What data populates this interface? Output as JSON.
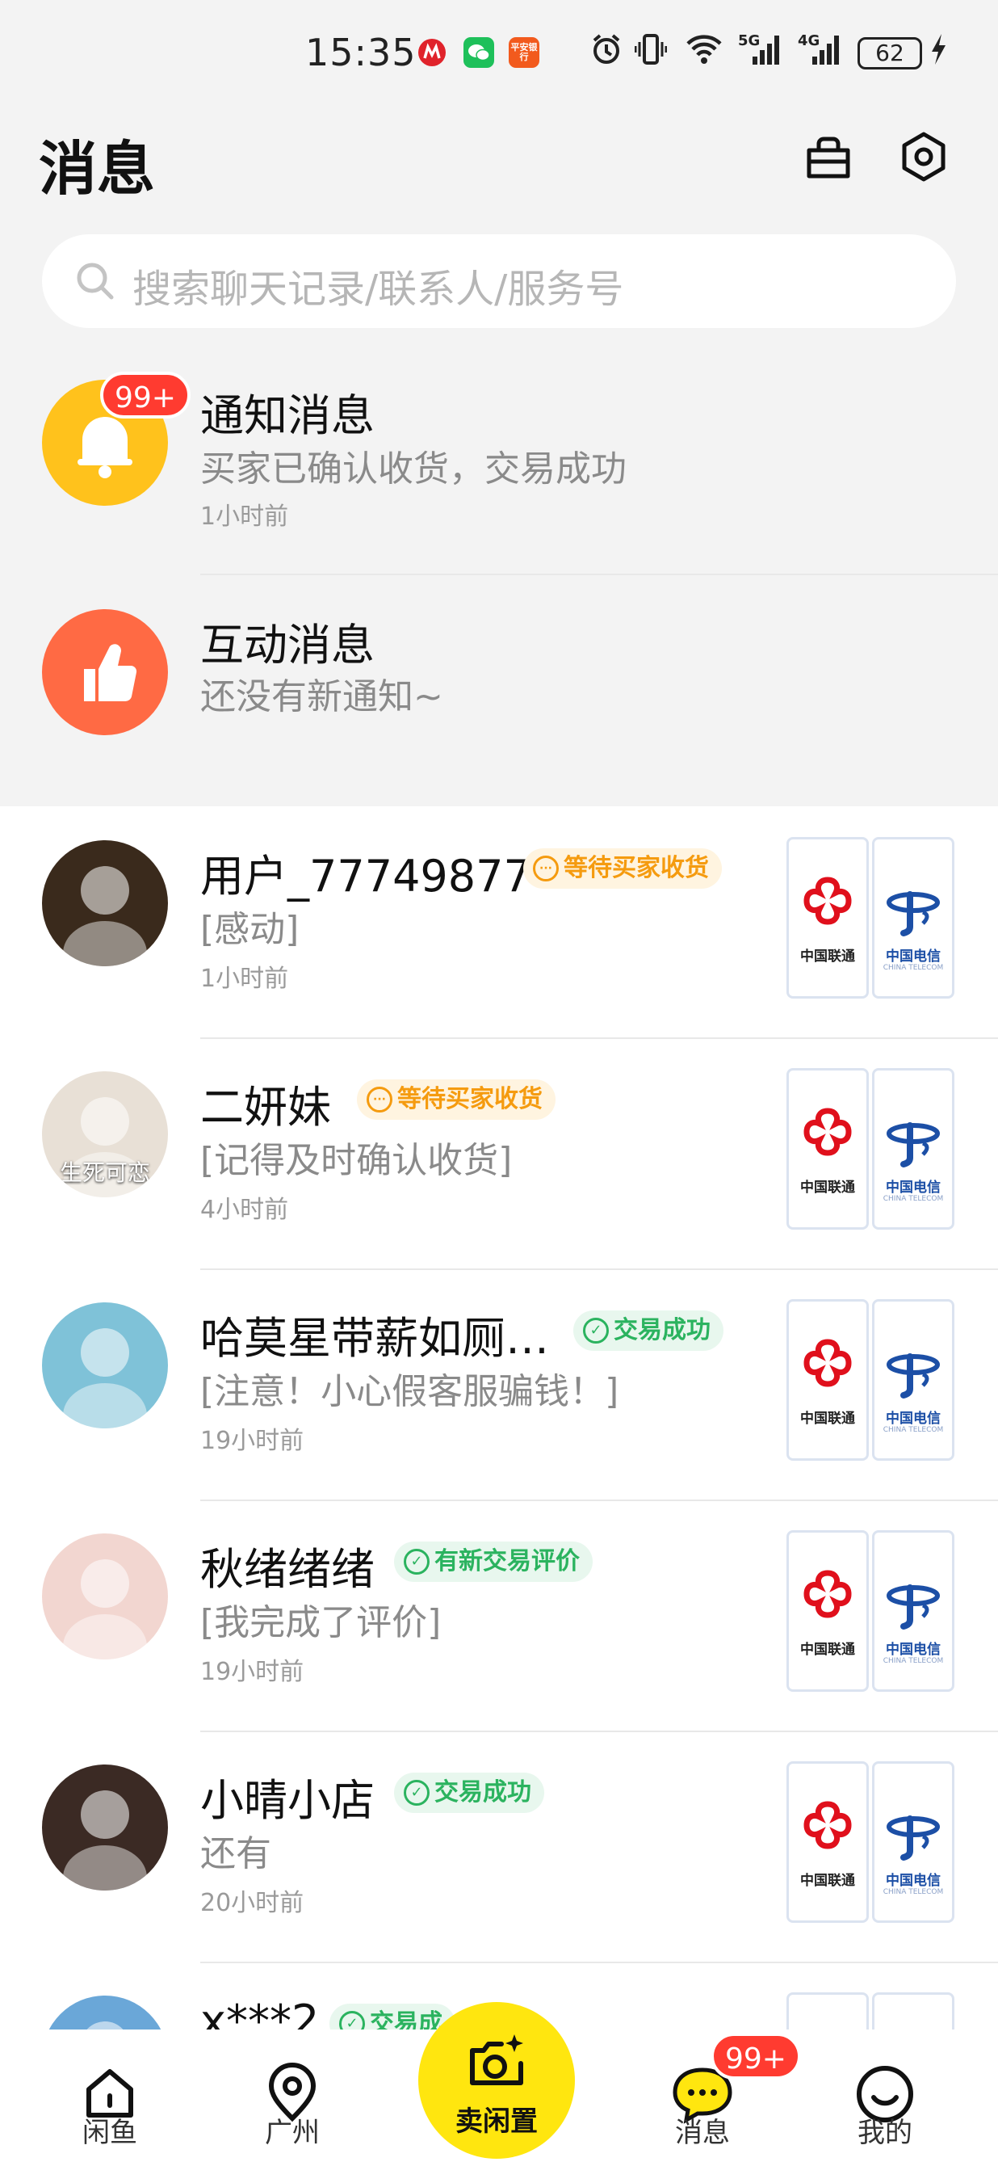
{
  "status_bar": {
    "time": "15:35",
    "battery": "62",
    "network_labels": [
      "5G",
      "4G"
    ],
    "icons": [
      "cmb-bank-icon",
      "wechat-icon",
      "pingan-bank-icon",
      "alarm-icon",
      "vibrate-icon",
      "wifi-icon",
      "signal-5g-icon",
      "signal-4g-icon",
      "battery-icon",
      "charging-icon"
    ],
    "app_icon_labels": {
      "pingan": "平安银行"
    }
  },
  "header": {
    "title": "消息",
    "icons": [
      "bag-icon",
      "settings-hex-icon"
    ]
  },
  "search": {
    "placeholder": "搜索聊天记录/联系人/服务号"
  },
  "system_messages": [
    {
      "title": "通知消息",
      "subtitle": "买家已确认收货，交易成功",
      "time": "1小时前",
      "badge": "99+",
      "icon": "bell-icon",
      "color": "#ffc21c"
    },
    {
      "title": "互动消息",
      "subtitle": "还没有新通知~",
      "time": "",
      "badge": "",
      "icon": "thumbs-up-icon",
      "color": "#ff6a44"
    }
  ],
  "chats": [
    {
      "name": "用户_77749877",
      "tag": "等待买家收货",
      "tag_type": "pending",
      "message": "[感动]",
      "time": "1小时前",
      "avatar_caption": ""
    },
    {
      "name": "二妍妹",
      "tag": "等待买家收货",
      "tag_type": "pending",
      "message": "[记得及时确认收货]",
      "time": "4小时前",
      "avatar_caption": "生死可恋"
    },
    {
      "name": "哈莫星带薪如厕…",
      "tag": "交易成功",
      "tag_type": "success",
      "message": "[注意！小心假客服骗钱！]",
      "time": "19小时前",
      "avatar_caption": ""
    },
    {
      "name": "秋绪绪绪",
      "tag": "有新交易评价",
      "tag_type": "success",
      "message": "[我完成了评价]",
      "time": "19小时前",
      "avatar_caption": ""
    },
    {
      "name": "小晴小店",
      "tag": "交易成功",
      "tag_type": "success",
      "message": "还有",
      "time": "20小时前",
      "avatar_caption": ""
    },
    {
      "name": "x***2",
      "tag": "交易成",
      "tag_type": "success",
      "message": "",
      "time": "",
      "avatar_caption": ""
    }
  ],
  "product_thumb": {
    "left_logo_text": "中国联通",
    "right_logo_text": "中国电信",
    "right_logo_subtext": "CHINA TELECOM"
  },
  "tab_bar": {
    "tabs": [
      {
        "label": "闲鱼",
        "icon": "home-icon"
      },
      {
        "label": "广州",
        "icon": "location-icon"
      },
      {
        "label": "卖闲置",
        "icon": "camera-sparkle-icon"
      },
      {
        "label": "消息",
        "icon": "chat-bubble-icon",
        "badge": "99+"
      },
      {
        "label": "我的",
        "icon": "smile-icon"
      }
    ]
  },
  "colors": {
    "accent_yellow": "#ffe60f",
    "badge_red": "#ff3b30",
    "tag_orange": "#f59b0f",
    "tag_green": "#2bb35f",
    "unicom_red": "#e0101c",
    "telecom_blue": "#1c4fa6"
  }
}
